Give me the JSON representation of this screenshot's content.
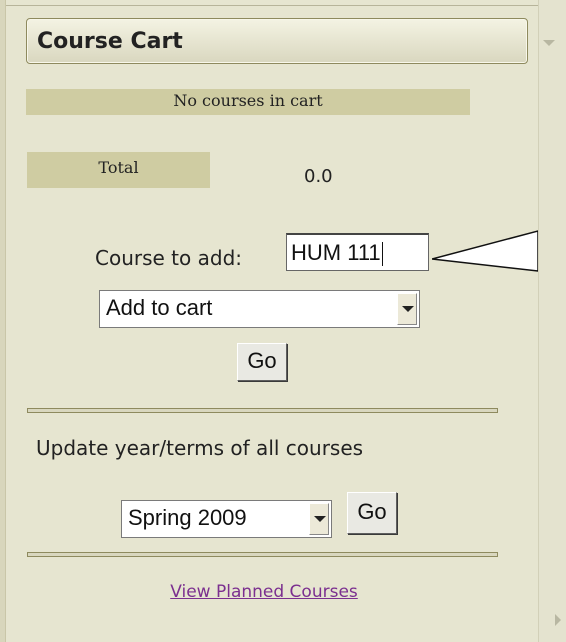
{
  "cart": {
    "title": "Course Cart",
    "empty_message": "No courses in cart",
    "total_label": "Total",
    "total_value": "0.0"
  },
  "add_course": {
    "label": "Course to add:",
    "input_value": "HUM 111",
    "action_select": "Add to cart",
    "go_label": "Go"
  },
  "update": {
    "label": "Update year/terms of all courses",
    "term_select": "Spring 2009",
    "go_label": "Go"
  },
  "links": {
    "view_planned": "View Planned Courses"
  },
  "icons": {
    "collapse": "chevron-down-icon",
    "scroll": "chevron-right-icon"
  },
  "colors": {
    "panel_bg": "#e6e5d0",
    "band": "#cfcca2",
    "header_border": "#8e8a5e",
    "link_visited": "#7b2f8f"
  }
}
